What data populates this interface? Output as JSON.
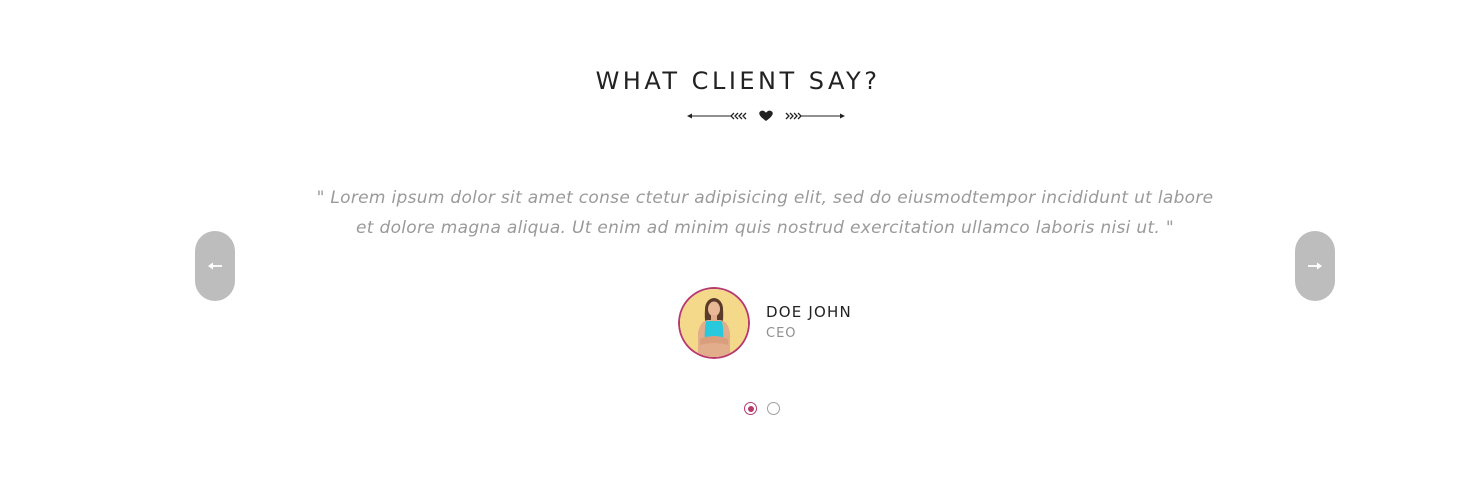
{
  "section": {
    "title": "WHAT CLIENT SAY?"
  },
  "testimonial": {
    "quote_line1": "\" Lorem ipsum dolor sit amet conse ctetur adipisicing elit, sed do eiusmodtempor incididunt ut labore",
    "quote_line2": "et dolore magna aliqua. Ut enim ad minim quis nostrud exercitation ullamco laboris nisi ut. \"",
    "author_name": "DOE JOHN",
    "author_role": "CEO"
  },
  "navigation": {
    "prev_label": "←",
    "next_label": "→",
    "prev_icon": "arrow-left-icon",
    "next_icon": "arrow-right-icon",
    "dots": [
      {
        "active": true
      },
      {
        "active": false
      }
    ]
  },
  "colors": {
    "accent": "#b73a6e",
    "title": "#222222",
    "quote_text": "#9a9a9a",
    "nav_button": "#bdbdbd",
    "avatar_bg": "#f4d98a",
    "avatar_shirt": "#28c9dc"
  }
}
